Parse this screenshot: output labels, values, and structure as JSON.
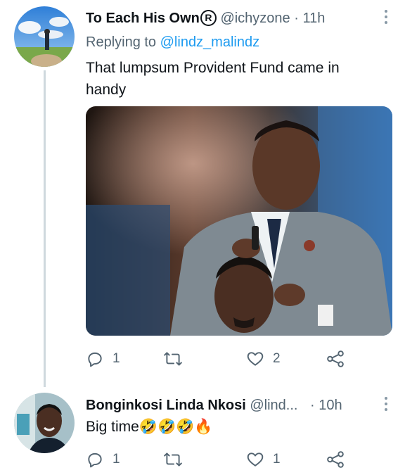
{
  "tweets": [
    {
      "display_name": "To Each His Own",
      "handle": "@ichyzone",
      "separator": "·",
      "time": "11h",
      "replying_prefix": "Replying to",
      "replying_to": "@lindz_malindz",
      "text_line1": "That lumpsum Provident Fund came in",
      "text_line2": "handy",
      "media_description": "photo",
      "reply_count": "1",
      "retweet_count": "",
      "like_count": "2"
    },
    {
      "display_name": "Bonginkosi Linda Nkosi",
      "handle": "@lind...",
      "separator": "·",
      "time": "10h",
      "text": "Big time🤣🤣🤣🔥",
      "reply_count": "1",
      "retweet_count": "",
      "like_count": "1"
    }
  ],
  "icons": [
    "reply-icon",
    "retweet-icon",
    "like-icon",
    "share-icon",
    "more-icon",
    "registered-icon"
  ],
  "colors": {
    "link": "#1d9bf0",
    "secondary": "#536471",
    "thread": "#cfd9de"
  }
}
